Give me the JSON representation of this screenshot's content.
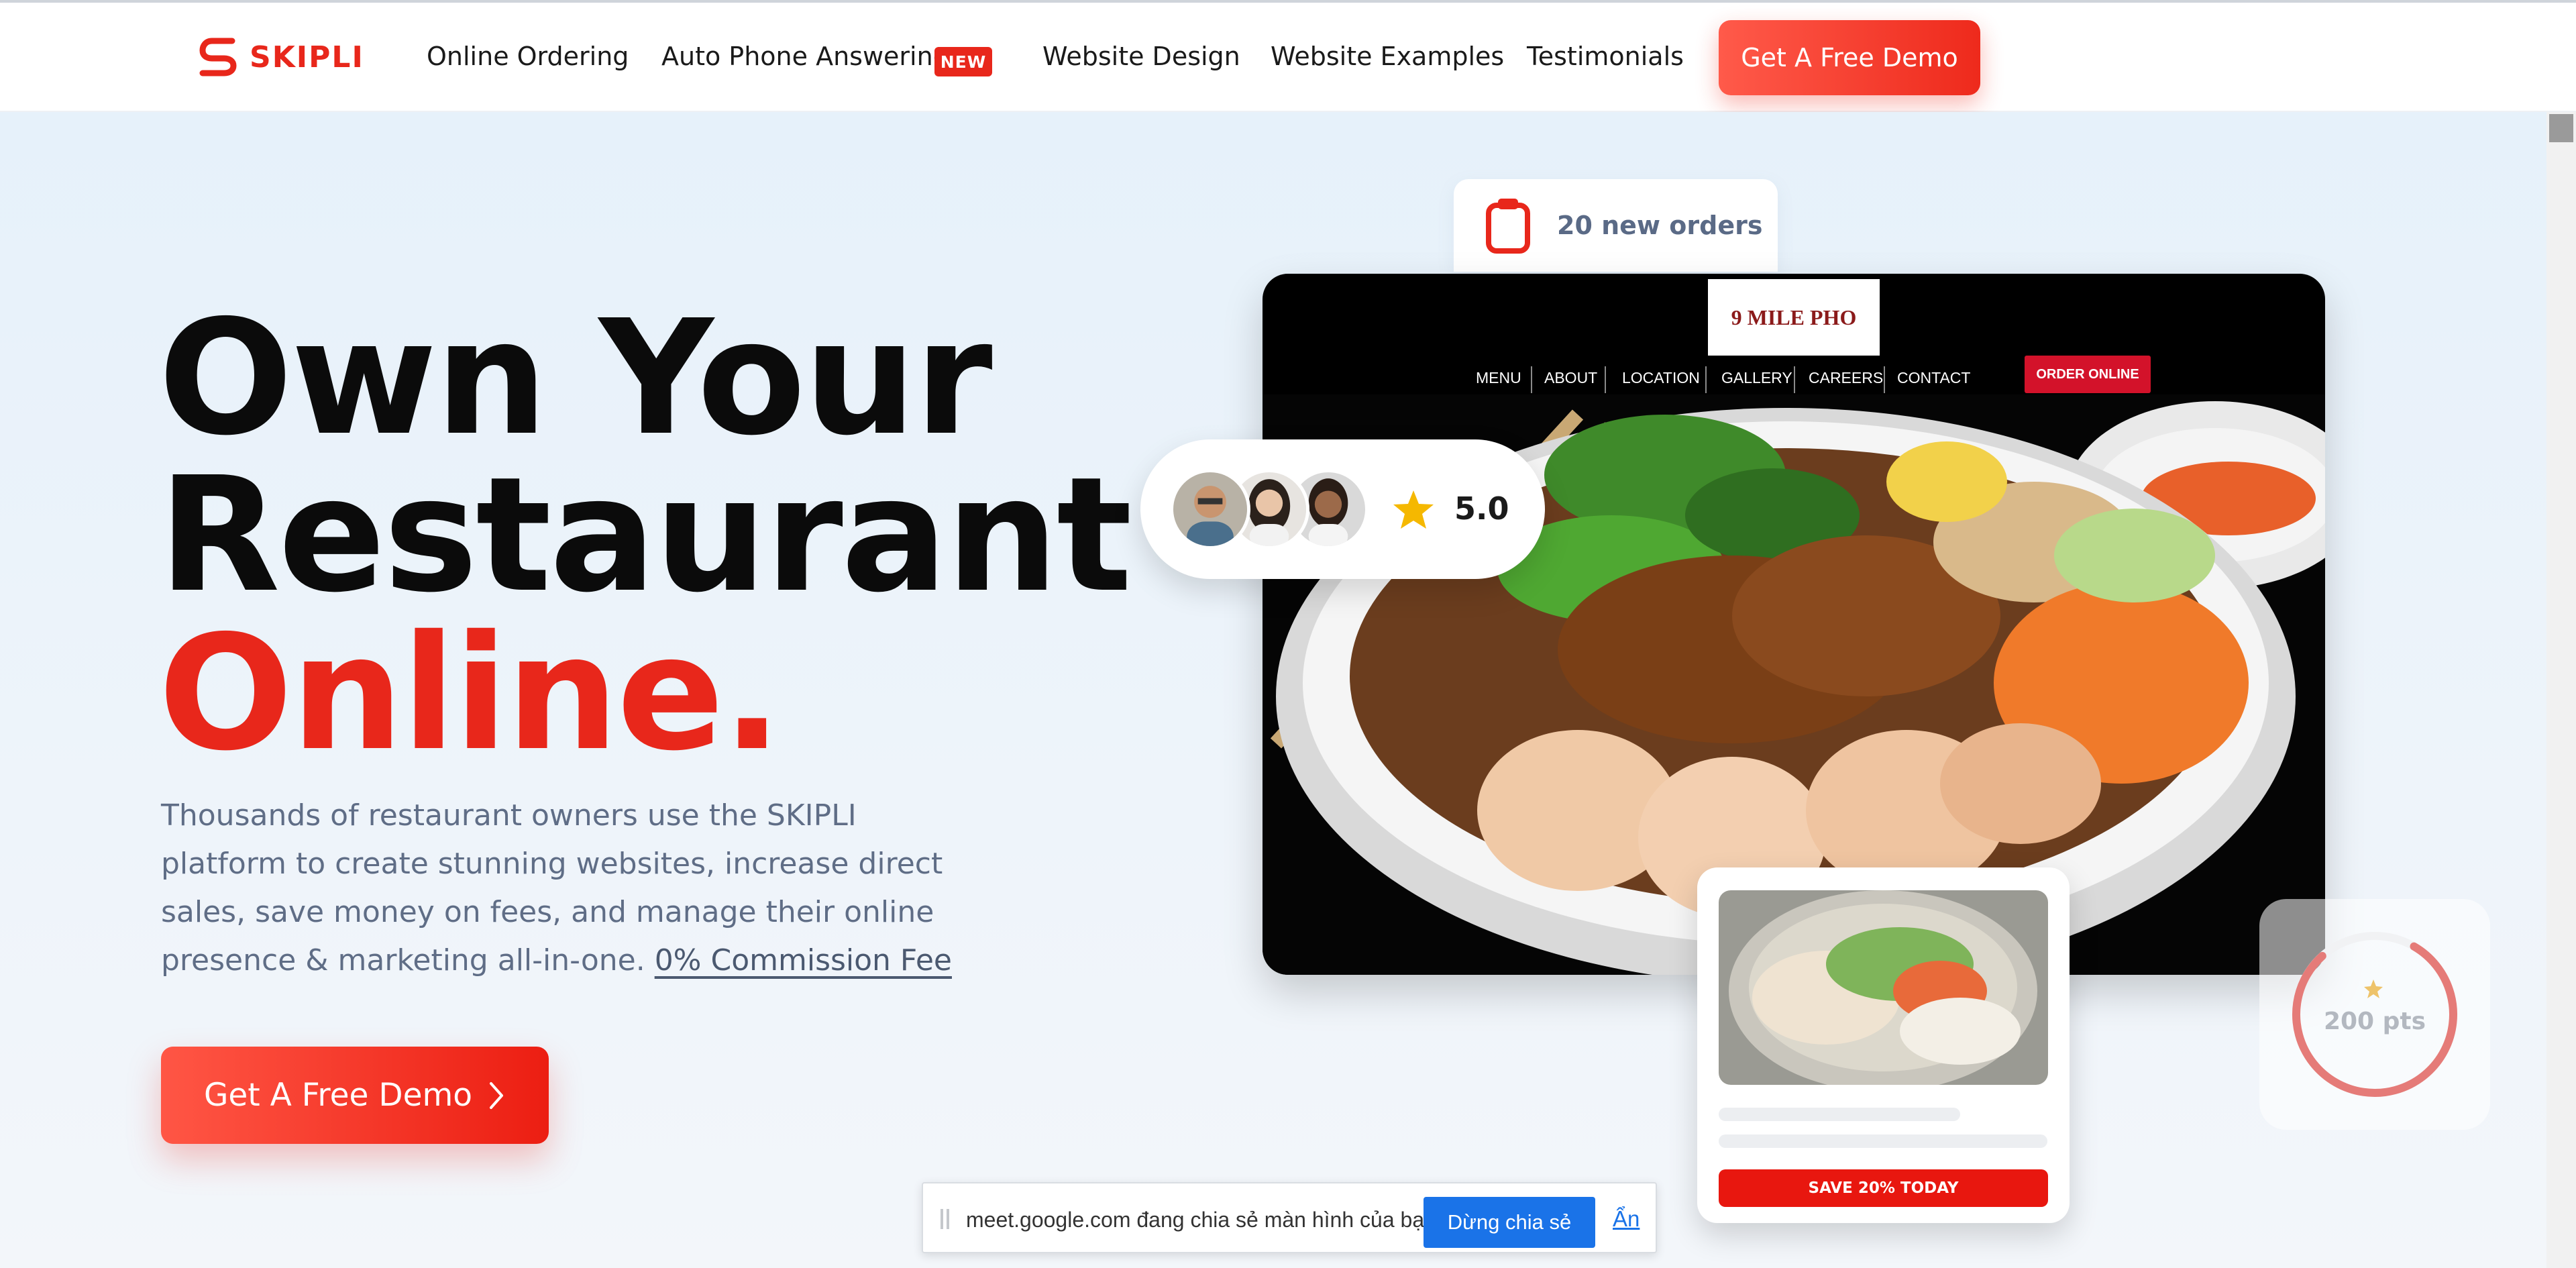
{
  "header": {
    "logo_text": "SKIPLI",
    "nav": [
      {
        "label": "Online Ordering"
      },
      {
        "label": "Auto Phone Answering",
        "badge": "NEW"
      },
      {
        "label": "Website Design"
      },
      {
        "label": "Website Examples"
      },
      {
        "label": "Testimonials"
      }
    ],
    "cta_label": "Get A Free Demo"
  },
  "hero": {
    "headline_line1": "Own Your",
    "headline_line2": "Restaurant",
    "headline_line3": "Online.",
    "subtext": "Thousands of restaurant owners use the SKIPLI platform to create stunning websites, increase direct sales, save money on fees, and manage their online presence & marketing all-in-one.",
    "subtext_link": "0% Commission Fee",
    "cta_label": "Get A Free Demo"
  },
  "orders_card": {
    "text": "20 new orders",
    "icon": "clipboard-icon"
  },
  "site_preview": {
    "logo_text": "9 MILE PHO",
    "nav": [
      "MENU",
      "ABOUT",
      "LOCATION",
      "GALLERY",
      "CAREERS",
      "CONTACT"
    ],
    "order_label": "ORDER ONLINE"
  },
  "rating": {
    "value": "5.0",
    "icon": "star-icon"
  },
  "promo": {
    "button_label": "SAVE 20% TODAY"
  },
  "points": {
    "text": "200 pts",
    "progress": 0.8
  },
  "share_bar": {
    "message": "meet.google.com đang chia sẻ màn hình của bạn.",
    "stop_label": "Dừng chia sẻ",
    "hide_label": "Ẩn"
  },
  "colors": {
    "brand_red": "#e8271b",
    "link_blue": "#1a73e8",
    "text_muted": "#5f6d86"
  }
}
